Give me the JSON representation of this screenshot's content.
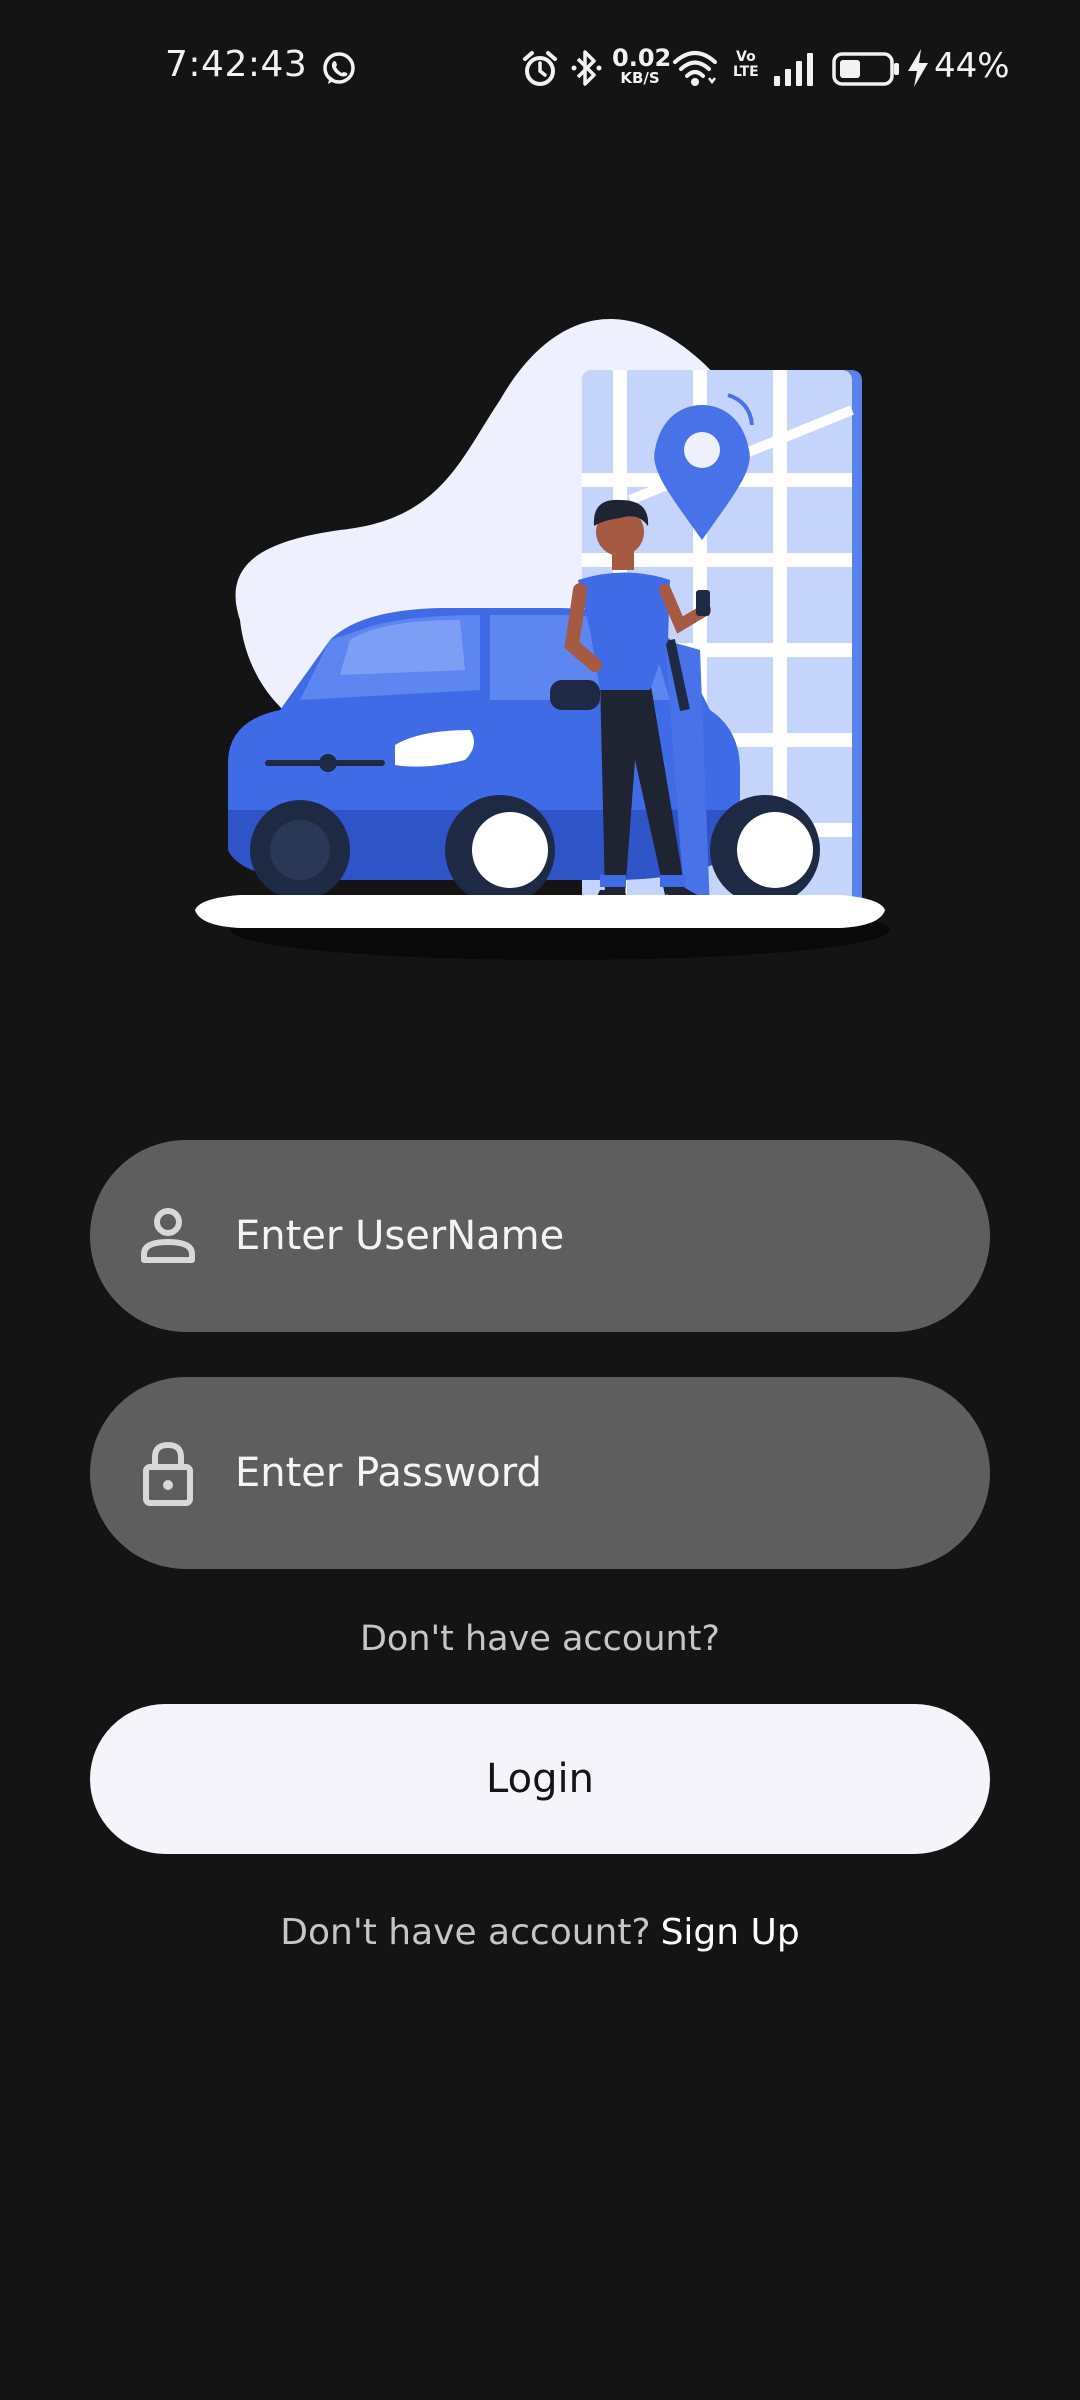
{
  "status_bar": {
    "time": "7:42:43",
    "net_speed_value": "0.02",
    "net_speed_unit": "KB/S",
    "volte_top": "Vo",
    "volte_bottom": "LTE",
    "battery_percent": "44%",
    "battery_level": 0.44,
    "icons": [
      "whatsapp-icon",
      "alarm-icon",
      "bluetooth-icon",
      "wifi-icon",
      "signal-icon",
      "battery-icon",
      "charging-bolt-icon"
    ]
  },
  "hero": {
    "illustration": "person-with-car-and-map-pin",
    "colors": {
      "blob": "#eef1fd",
      "car": "#3f6be6",
      "map": "#c5d4fb",
      "pin": "#4a72e8"
    }
  },
  "form": {
    "username": {
      "placeholder": "Enter UserName",
      "value": "",
      "icon": "user-icon"
    },
    "password": {
      "placeholder": "Enter Password",
      "value": "",
      "icon": "lock-icon"
    },
    "no_account_hint": "Don't have account?",
    "login_label": "Login",
    "signup_prompt": "Don't have account?",
    "signup_link": "Sign Up"
  },
  "colors": {
    "background": "#141414",
    "field_background": "#5e5e5e",
    "button_background": "#f4f4fa"
  }
}
